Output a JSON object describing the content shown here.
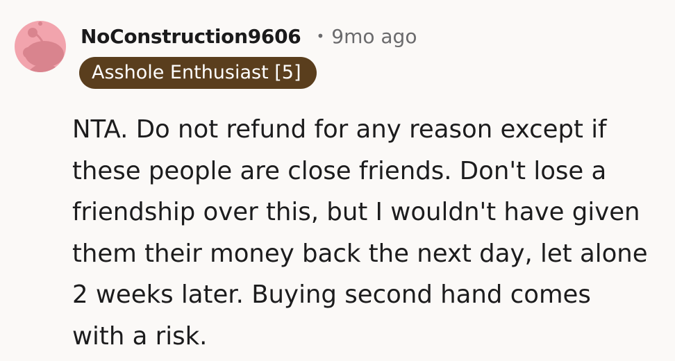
{
  "comment": {
    "username": "NoConstruction9606",
    "separator": "•",
    "timestamp": "9mo ago",
    "flair": "Asshole Enthusiast [5]",
    "avatar_icon": "snoo-avatar-icon",
    "body_lines": [
      "NTA. Do not refund for any reason except if",
      "these people are close friends. Don't lose a",
      "friendship over this, but I wouldn't have given",
      "them their money back the next day, let alone",
      "2 weeks later. Buying second hand comes",
      "with a risk."
    ]
  },
  "colors": {
    "background": "#fbf9f7",
    "avatar_bg": "#f2a4ad",
    "avatar_snoo": "#d9848e",
    "flair_bg": "#5a3e1d",
    "flair_text": "#ffffff",
    "meta_text": "#6a6a6c"
  }
}
